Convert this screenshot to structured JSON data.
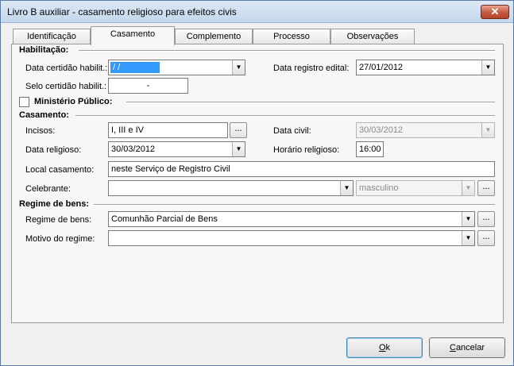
{
  "window": {
    "title": "Livro B auxiliar - casamento religioso para efeitos civis",
    "close_label": "✕"
  },
  "tabs": [
    {
      "label": "Identificação",
      "active": false
    },
    {
      "label": "Casamento",
      "active": true
    },
    {
      "label": "Complemento",
      "active": false
    },
    {
      "label": "Processo",
      "active": false
    },
    {
      "label": "Observações",
      "active": false
    }
  ],
  "habilitacao": {
    "section_label": "Habilitação:",
    "data_certidao_label": "Data certidão habilit.:",
    "data_certidao_value": " /  /",
    "data_registro_label": "Data registro edital:",
    "data_registro_value": "27/01/2012",
    "selo_label": "Selo certidão habilit.:",
    "selo_value": "-"
  },
  "ministerio": {
    "label": "Ministério Público:",
    "checked": false
  },
  "casamento": {
    "section_label": "Casamento:",
    "incisos_label": "Incisos:",
    "incisos_value": "I, III e IV",
    "data_civil_label": "Data civil:",
    "data_civil_value": "30/03/2012",
    "data_religioso_label": "Data religioso:",
    "data_religioso_value": "30/03/2012",
    "horario_label": "Horário religioso:",
    "horario_value": "16:00",
    "local_label": "Local casamento:",
    "local_value": "neste Serviço de Registro Civil",
    "celebrante_label": "Celebrante:",
    "celebrante_value": "",
    "genero_value": "masculino"
  },
  "regime": {
    "section_label": "Regime de bens:",
    "regime_label": "Regime de bens:",
    "regime_value": "Comunhão Parcial de Bens",
    "motivo_label": "Motivo do regime:",
    "motivo_value": ""
  },
  "ellipsis_label": "...",
  "buttons": {
    "ok_mnemonic": "O",
    "ok_rest": "k",
    "cancel_mnemonic": "C",
    "cancel_rest": "ancelar"
  }
}
